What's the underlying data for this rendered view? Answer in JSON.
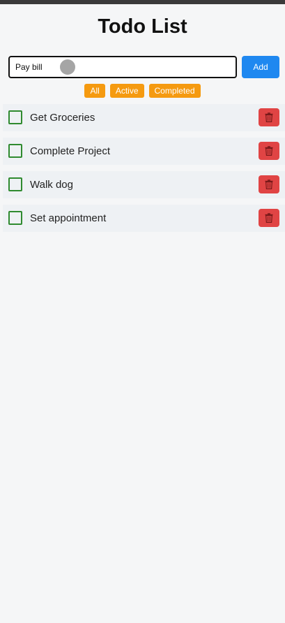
{
  "header": {
    "title": "Todo List"
  },
  "input": {
    "value": "Pay bill",
    "add_label": "Add"
  },
  "filters": [
    {
      "label": "All"
    },
    {
      "label": "Active"
    },
    {
      "label": "Completed"
    }
  ],
  "todos": [
    {
      "text": "Get Groceries",
      "completed": false
    },
    {
      "text": "Complete Project",
      "completed": false
    },
    {
      "text": "Walk dog",
      "completed": false
    },
    {
      "text": "Set appointment",
      "completed": false
    }
  ],
  "icons": {
    "delete": "trash-icon"
  },
  "colors": {
    "add_button": "#1f88f0",
    "filter_button": "#f59a10",
    "checkbox_border": "#2f8a2f",
    "delete_button": "#e04444",
    "background": "#f5f6f7"
  }
}
